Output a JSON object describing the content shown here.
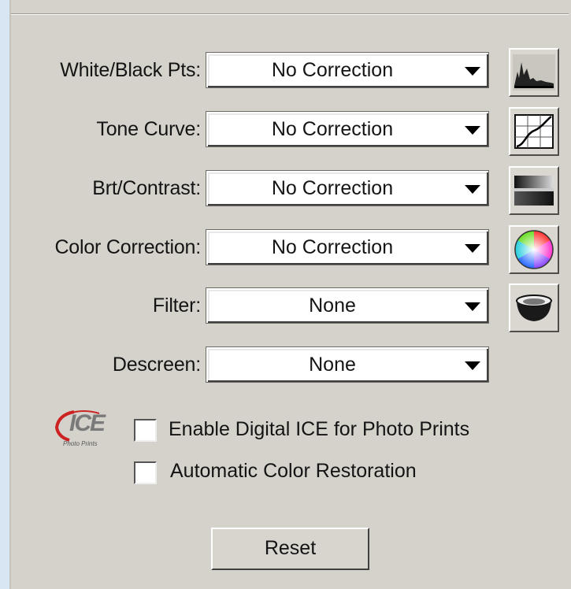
{
  "rows": [
    {
      "label": "White/Black Pts:",
      "value": "No Correction",
      "tool_icon": "histogram-icon"
    },
    {
      "label": "Tone Curve:",
      "value": "No Correction",
      "tool_icon": "tone-curve-icon"
    },
    {
      "label": "Brt/Contrast:",
      "value": "No Correction",
      "tool_icon": "brightness-contrast-icon"
    },
    {
      "label": "Color Correction:",
      "value": "No Correction",
      "tool_icon": "color-wheel-icon"
    },
    {
      "label": "Filter:",
      "value": "None",
      "tool_icon": "filter-bowl-icon"
    },
    {
      "label": "Descreen:",
      "value": "None"
    }
  ],
  "ice": {
    "logo_text": "ICE",
    "logo_sub": "Photo Prints",
    "enable_label": "Enable Digital ICE for Photo Prints",
    "restoration_label": "Automatic Color Restoration",
    "enable_checked": false,
    "restoration_checked": false
  },
  "reset_label": "Reset"
}
